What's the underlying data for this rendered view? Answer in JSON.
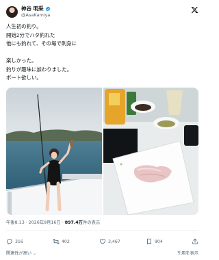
{
  "author": {
    "display_name": "神谷 明采",
    "handle": "@AsaKamiya"
  },
  "tweet": {
    "lines": [
      "人生初の釣り。",
      "開始2分でハタ釣れた",
      "他にも釣れて、その場で刺身に",
      "",
      "楽しかった。",
      "釣りが趣味に加わりました。",
      "ボート欲しい。"
    ]
  },
  "meta": {
    "time": "午後8:13",
    "separator": "·",
    "date": "2026年9月16日",
    "views_count": "897.4万",
    "views_label": "件の表示"
  },
  "actions": {
    "reply_count": "316",
    "retweet_count": "402",
    "like_count": "3,467",
    "bookmark_count": "904"
  },
  "footer": {
    "left": "関連性が高い",
    "right": "引用を表示"
  },
  "colors": {
    "text": "#0f1419",
    "secondary": "#536471",
    "verified": "#1d9bf0"
  },
  "icons": [
    "x-logo-icon",
    "verified-badge-icon",
    "reply-icon",
    "retweet-icon",
    "like-icon",
    "bookmark-icon",
    "share-icon",
    "chevron-down-icon"
  ]
}
